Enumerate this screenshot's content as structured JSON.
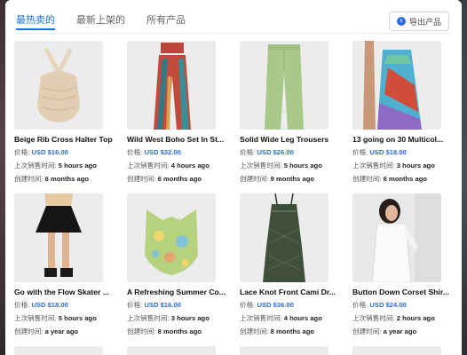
{
  "tabs": [
    {
      "label": "最热卖的",
      "active": true
    },
    {
      "label": "最新上架的",
      "active": false
    },
    {
      "label": "所有产品",
      "active": false
    }
  ],
  "export_button": {
    "label": "导出产品",
    "icon": "download-icon"
  },
  "labels": {
    "price": "价格:",
    "last_sold": "上次销售时间:",
    "created": "创建时间:"
  },
  "products": [
    {
      "title": "Beige Rib Cross Halter Top",
      "price": "USD $16.00",
      "last_sold": "5 hours ago",
      "created": "6 months ago",
      "image": "beige-halter-top"
    },
    {
      "title": "Wild West Boho Set In St...",
      "price": "USD $32.00",
      "last_sold": "4 hours ago",
      "created": "6 months ago",
      "image": "boho-set"
    },
    {
      "title": "Solid Wide Leg Trousers",
      "price": "USD $26.00",
      "last_sold": "5 hours ago",
      "created": "9 months ago",
      "image": "green-trousers"
    },
    {
      "title": "13 going on 30 Multicol...",
      "price": "USD $18.00",
      "last_sold": "3 hours ago",
      "created": "6 months ago",
      "image": "multicolor-dress"
    },
    {
      "title": "Go with the Flow Skater ...",
      "price": "USD $18.00",
      "last_sold": "5 hours ago",
      "created": "a year ago",
      "image": "black-skater-skirt"
    },
    {
      "title": "A Refreshing Summer Co...",
      "price": "USD $16.00",
      "last_sold": "3 hours ago",
      "created": "8 months ago",
      "image": "floral-corset"
    },
    {
      "title": "Lace Knot Front Cami Dr...",
      "price": "USD $36.00",
      "last_sold": "4 hours ago",
      "created": "8 months ago",
      "image": "lace-cami-dress"
    },
    {
      "title": "Button Down Corset Shir...",
      "price": "USD $24.00",
      "last_sold": "2 hours ago",
      "created": "a year ago",
      "image": "white-shirt-dress"
    }
  ]
}
